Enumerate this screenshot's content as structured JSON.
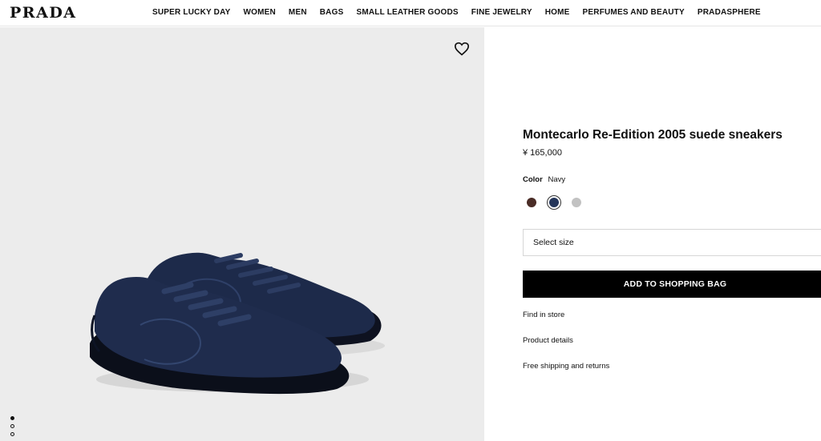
{
  "brand": {
    "logo": "PRADA"
  },
  "nav": [
    {
      "label": "SUPER LUCKY DAY"
    },
    {
      "label": "WOMEN"
    },
    {
      "label": "MEN"
    },
    {
      "label": "BAGS"
    },
    {
      "label": "SMALL LEATHER GOODS"
    },
    {
      "label": "FINE JEWELRY"
    },
    {
      "label": "HOME"
    },
    {
      "label": "PERFUMES AND BEAUTY"
    },
    {
      "label": "PRADASPHERE"
    }
  ],
  "gallery": {
    "wishlist_icon": "heart-outline-icon",
    "dots": 3,
    "active_dot": 1,
    "background": "#ececec"
  },
  "product": {
    "title": "Montecarlo Re-Edition 2005 suede sneakers",
    "price": "¥ 165,000",
    "color_label": "Color",
    "color_value": "Navy",
    "swatches": [
      {
        "name": "brown",
        "color": "#4a2c26"
      },
      {
        "name": "navy",
        "color": "#25365a",
        "selected": true
      },
      {
        "name": "grey",
        "color": "#c2c2c2"
      }
    ],
    "size_placeholder": "Select size",
    "add_to_bag": "ADD TO SHOPPING BAG",
    "links": [
      "Find in store",
      "Product details",
      "Free shipping and returns"
    ]
  }
}
